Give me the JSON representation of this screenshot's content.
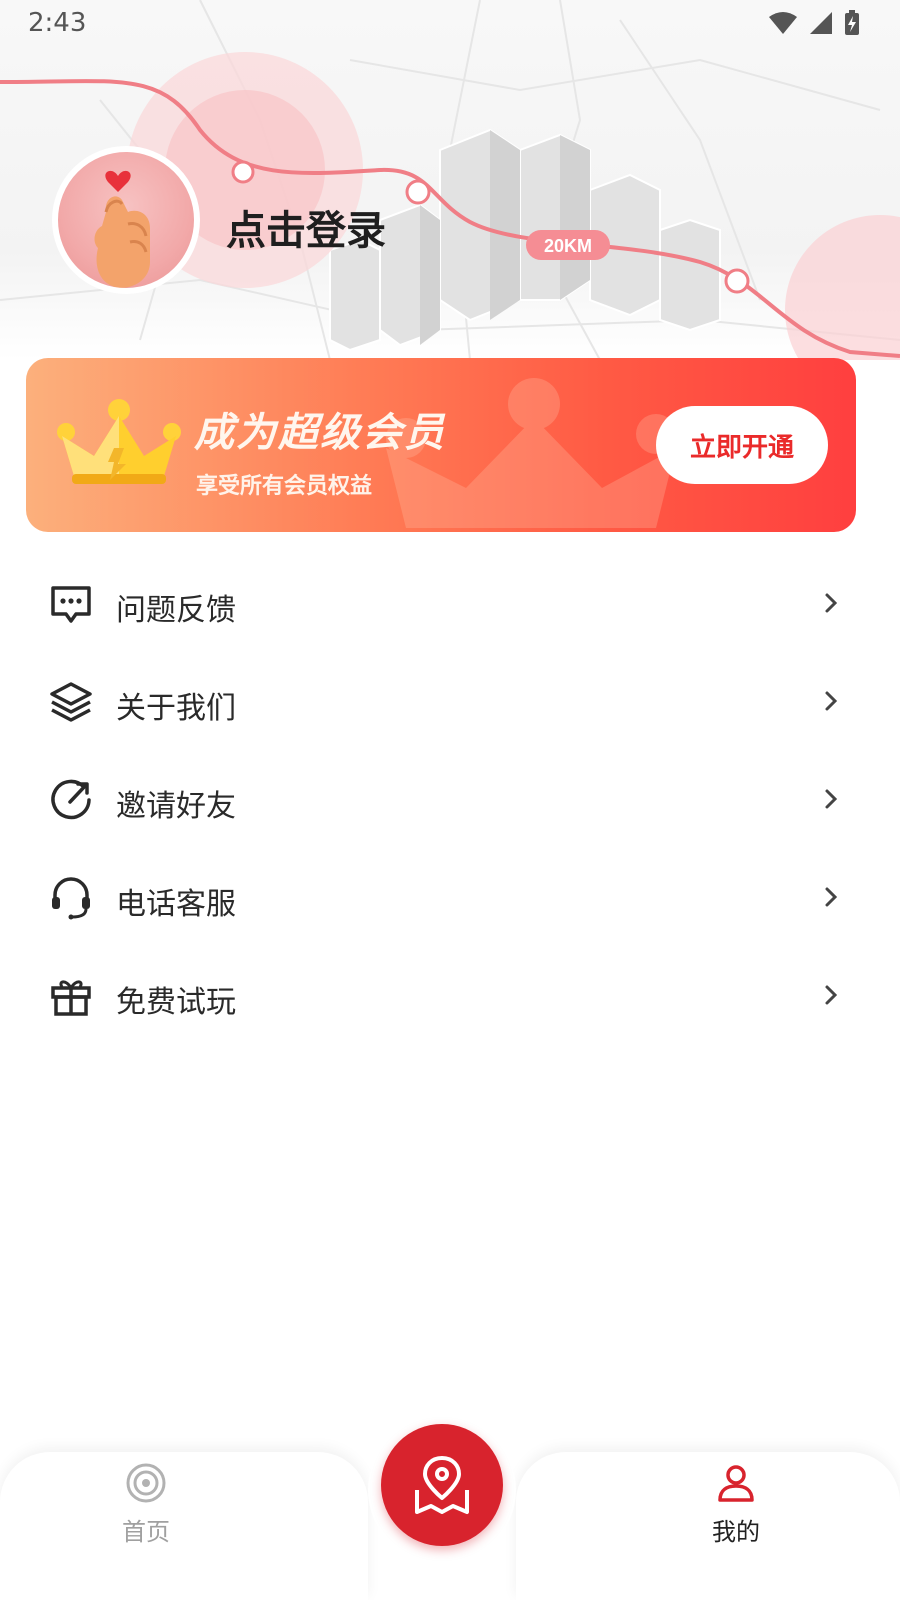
{
  "status_bar": {
    "time": "2:43",
    "icons": [
      "wifi-icon",
      "signal-icon",
      "battery-icon"
    ]
  },
  "header": {
    "login_text": "点击登录",
    "distance_badge": "20KM",
    "avatar_icon": "finger-heart-icon"
  },
  "vip_banner": {
    "title": "成为超级会员",
    "subtitle": "享受所有会员权益",
    "button_label": "立即开通",
    "icon": "crown-icon"
  },
  "menu": {
    "items": [
      {
        "label": "问题反馈",
        "icon": "feedback-icon"
      },
      {
        "label": "关于我们",
        "icon": "layers-icon"
      },
      {
        "label": "邀请好友",
        "icon": "share-icon"
      },
      {
        "label": "电话客服",
        "icon": "headset-icon"
      },
      {
        "label": "免费试玩",
        "icon": "gift-icon"
      }
    ]
  },
  "bottom_nav": {
    "home_label": "首页",
    "mine_label": "我的",
    "active": "我的"
  },
  "colors": {
    "accent": "#d8232d",
    "banner_start": "#fcb07c",
    "banner_end": "#ff3f3f",
    "button_text": "#ea2a2a",
    "route_line": "#f07e86"
  }
}
